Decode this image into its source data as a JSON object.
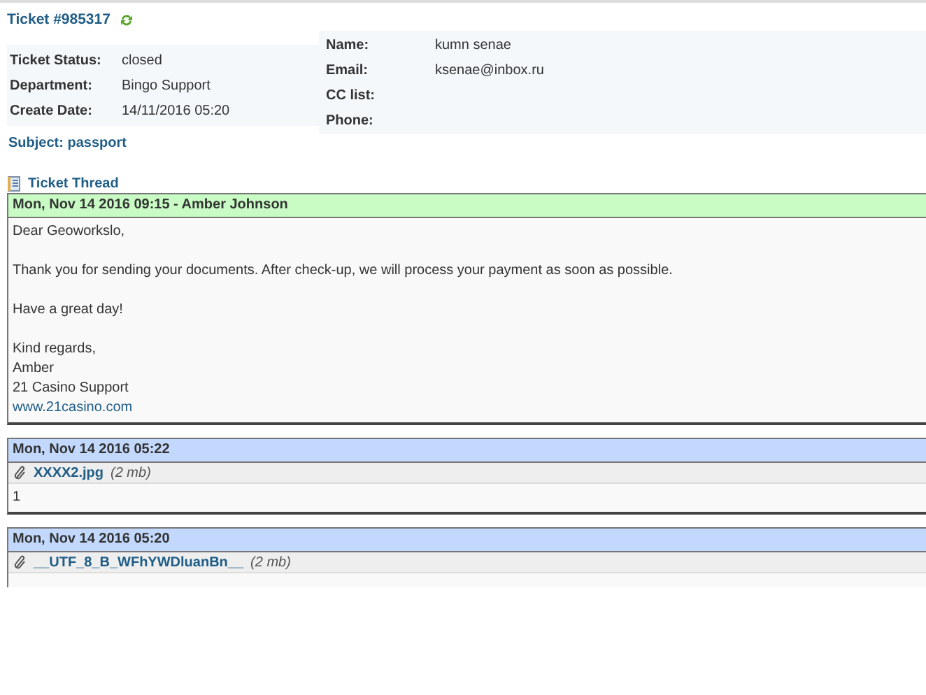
{
  "ticket": {
    "title": "Ticket #985317"
  },
  "info_left": [
    {
      "label": "Ticket Status:",
      "value": "closed"
    },
    {
      "label": "Department:",
      "value": "Bingo Support"
    },
    {
      "label": "Create Date:",
      "value": "14/11/2016 05:20"
    }
  ],
  "info_right": [
    {
      "label": "Name:",
      "value": "kumn senae"
    },
    {
      "label": "Email:",
      "value": "ksenae@inbox.ru"
    },
    {
      "label": "CC list:"
    },
    {
      "label": "Phone:"
    }
  ],
  "subject": "Subject: passport",
  "thread_title": "Ticket Thread",
  "entries": [
    {
      "kind": "response",
      "header": "Mon, Nov 14 2016 09:15 - Amber Johnson",
      "paragraphs": [
        [
          "Dear Geoworkslo,"
        ],
        [
          "Thank you for sending your documents. After check-up, we will process your payment as soon as possible."
        ],
        [
          "Have a great day!"
        ],
        [
          "Kind regards,",
          "Amber",
          "21 Casino Support"
        ]
      ],
      "link": "www.21casino.com"
    },
    {
      "kind": "message",
      "header": "Mon, Nov 14 2016 05:22",
      "attachment": {
        "name": "XXXX2.jpg",
        "size": "(2 mb)"
      },
      "paragraphs": [
        [
          "1"
        ]
      ]
    },
    {
      "kind": "message",
      "header": "Mon, Nov 14 2016 05:20",
      "attachment": {
        "name": "__UTF_8_B_WFhYWDluanBn__",
        "size": "(2 mb)"
      }
    }
  ]
}
